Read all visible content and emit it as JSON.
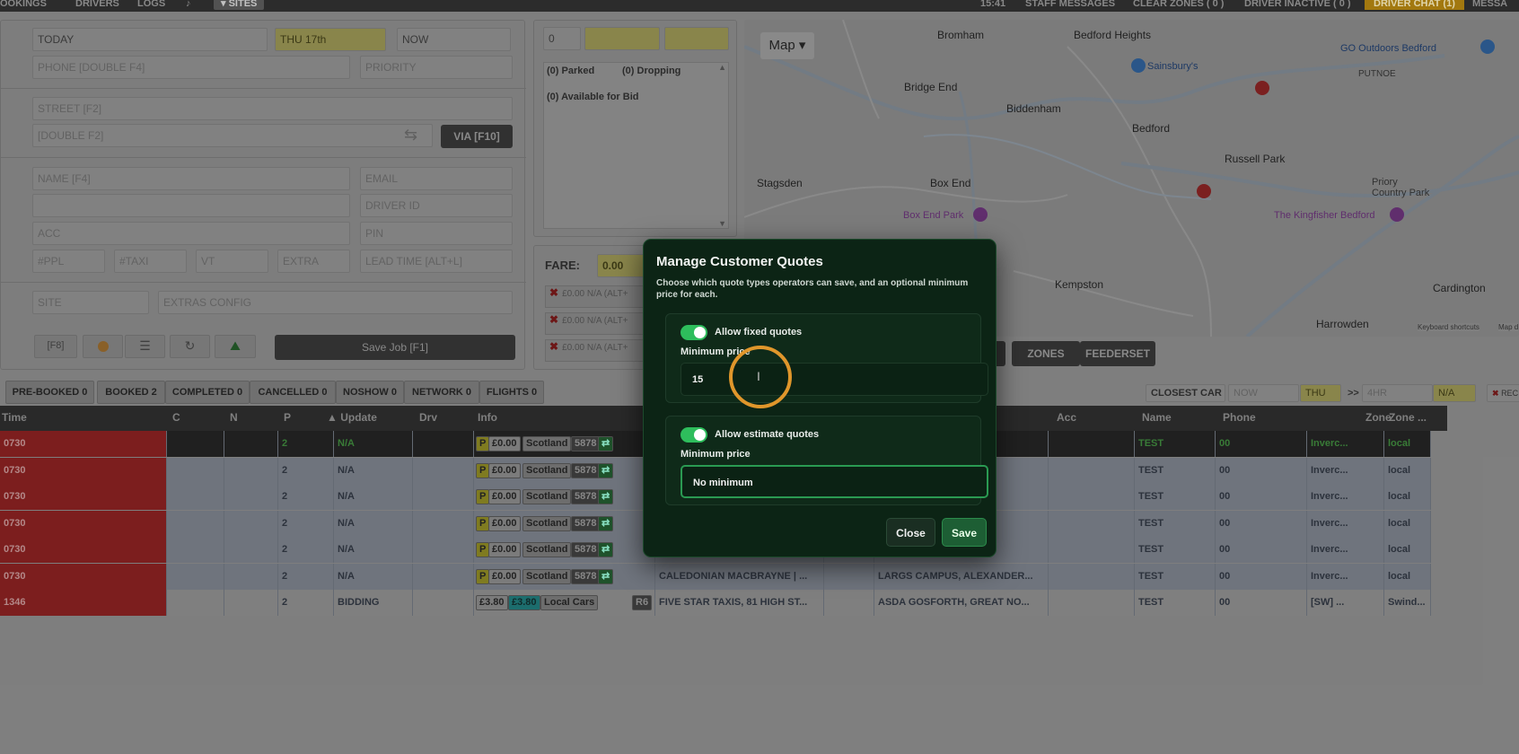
{
  "topbar": {
    "items": [
      "OOKINGS",
      "DRIVERS",
      "LOGS"
    ],
    "sites": "▾ SITES",
    "time": "15:41",
    "right": [
      "STAFF MESSAGES",
      "CLEAR ZONES ( 0 )",
      "DRIVER INACTIVE ( 0 )"
    ],
    "chat": "DRIVER CHAT (1)",
    "message": "MESSA"
  },
  "booking": {
    "date": "TODAY",
    "day": "THU 17th",
    "when": "NOW",
    "phone": "PHONE [DOUBLE F4]",
    "priority": "PRIORITY",
    "street": "STREET [F2]",
    "double_f2": "[DOUBLE F2]",
    "via": "VIA [F10]",
    "name": "NAME [F4]",
    "email": "EMAIL",
    "driver_id": "DRIVER ID",
    "acc": "ACC",
    "pin": "PIN",
    "ppl": "#PPL",
    "taxi": "#TAXI",
    "vt": "VT",
    "extra": "EXTRA",
    "lead": "LEAD TIME [ALT+L]",
    "site": "SITE",
    "extras_config": "EXTRAS CONFIG",
    "f8": "[F8]",
    "save": "Save Job [F1]"
  },
  "status": {
    "count": "0",
    "parked": "(0) Parked",
    "dropping": "(0) Dropping",
    "available": "(0) Available for Bid",
    "fare_label": "FARE:",
    "fare": "0.00",
    "lines": [
      "£0.00 N/A (ALT+",
      "£0.00 N/A (ALT+",
      "£0.00 N/A (ALT+"
    ]
  },
  "map": {
    "type_button": "Map ▾",
    "places": [
      "Bromham",
      "Bedford Heights",
      "Sainsbury's",
      "GO Outdoors Bedford",
      "PUTNOE",
      "Bridge End",
      "Biddenham",
      "Bedford",
      "Russell Park",
      "Stagsden",
      "Box End",
      "Box End Park",
      "Priory Country Park",
      "The Kingfisher Bedford",
      "Kempston",
      "Cardington",
      "Harrowden"
    ],
    "footer": "Keyboard shortcuts",
    "footer2": "Map d"
  },
  "mapbuttons": {
    "s": "S",
    "zones": "ZONES",
    "feederset": "FEEDERSET"
  },
  "tabs": [
    "PRE-BOOKED 0",
    "BOOKED 2",
    "COMPLETED 0",
    "CANCELLED 0",
    "NOSHOW 0",
    "NETWORK 0",
    "FLIGHTS 0"
  ],
  "filters": {
    "closest": "CLOSEST CAR",
    "now": "NOW",
    "thu": "THU",
    "gt": ">>",
    "hr": "4HR",
    "na": "N/A",
    "rec": "REC"
  },
  "columns": [
    "Time",
    "C",
    "N",
    "P",
    "▲ Update",
    "Drv",
    "Info",
    "Acc",
    "Name",
    "Phone",
    "Zone",
    "Zone ..."
  ],
  "rows": [
    {
      "time": "0730",
      "p": "2",
      "update": "N/A",
      "price": "£0.00",
      "tag": "Scotland",
      "num": "5878",
      "pickup": "",
      "dest": "ALEXANDER...",
      "name": "TEST",
      "phone": "00",
      "zone": "Inverc...",
      "zone2": "local"
    },
    {
      "time": "0730",
      "p": "2",
      "update": "N/A",
      "price": "£0.00",
      "tag": "Scotland",
      "num": "5878",
      "pickup": "",
      "dest": "ALEXANDER...",
      "name": "TEST",
      "phone": "00",
      "zone": "Inverc...",
      "zone2": "local"
    },
    {
      "time": "0730",
      "p": "2",
      "update": "N/A",
      "price": "£0.00",
      "tag": "Scotland",
      "num": "5878",
      "pickup": "",
      "dest": "ALEXANDER...",
      "name": "TEST",
      "phone": "00",
      "zone": "Inverc...",
      "zone2": "local"
    },
    {
      "time": "0730",
      "p": "2",
      "update": "N/A",
      "price": "£0.00",
      "tag": "Scotland",
      "num": "5878",
      "pickup": "",
      "dest": "ALEXANDER...",
      "name": "TEST",
      "phone": "00",
      "zone": "Inverc...",
      "zone2": "local"
    },
    {
      "time": "0730",
      "p": "2",
      "update": "N/A",
      "price": "£0.00",
      "tag": "Scotland",
      "num": "5878",
      "pickup": "",
      "dest": "ALEXANDER...",
      "name": "TEST",
      "phone": "00",
      "zone": "Inverc...",
      "zone2": "local"
    },
    {
      "time": "0730",
      "p": "2",
      "update": "N/A",
      "price": "£0.00",
      "tag": "Scotland",
      "num": "5878",
      "pickup": "CALEDONIAN MACBRAYNE | ...",
      "dest": "LARGS CAMPUS, ALEXANDER...",
      "name": "TEST",
      "phone": "00",
      "zone": "Inverc...",
      "zone2": "local"
    },
    {
      "time": "1346",
      "p": "2",
      "update": "BIDDING",
      "price": "£3.80",
      "price2": "£3.80",
      "tag": "Local Cars",
      "num": "R6",
      "pickup": "FIVE STAR TAXIS, 81 HIGH ST...",
      "dest": "ASDA GOSFORTH, GREAT NO...",
      "name": "TEST",
      "phone": "00",
      "zone": "[SW] ...",
      "zone2": "Swind..."
    }
  ],
  "modal": {
    "title": "Manage Customer Quotes",
    "subtitle": "Choose which quote types operators can save, and an optional minimum price for each.",
    "fixed_label": "Allow fixed quotes",
    "fixed_min_label": "Minimum price",
    "fixed_min_value": "15",
    "estimate_label": "Allow estimate quotes",
    "estimate_min_label": "Minimum price",
    "estimate_min_placeholder": "No minimum",
    "close": "Close",
    "save": "Save"
  },
  "colors": {
    "accent_green": "#2ebd5c",
    "highlight": "#e0962b",
    "modal_bg": "#0c2415"
  }
}
